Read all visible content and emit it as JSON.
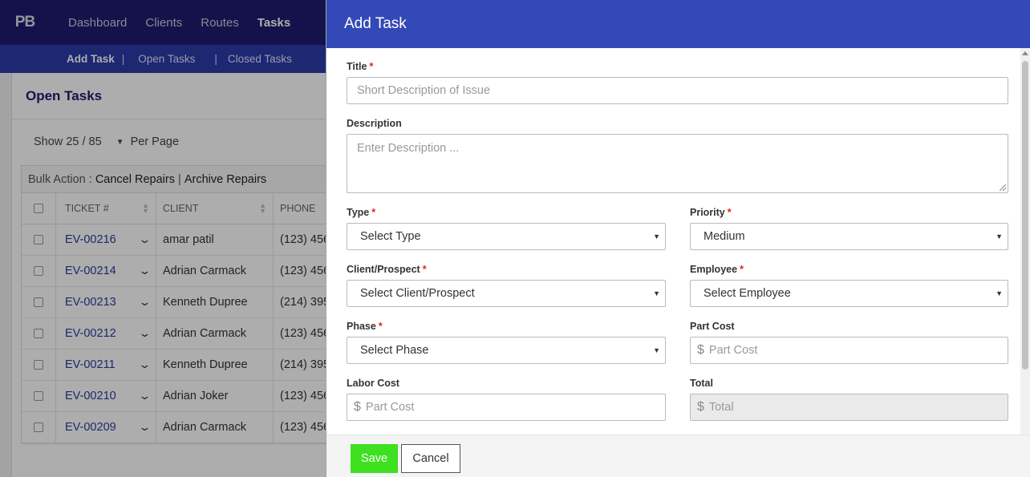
{
  "app": {
    "logo": "PB",
    "nav": [
      "Dashboard",
      "Clients",
      "Routes",
      "Tasks"
    ],
    "active_nav": "Tasks",
    "subnav": {
      "add_task": "Add Task",
      "open_tasks": "Open Tasks",
      "closed_tasks": "Closed Tasks",
      "separator": "|"
    }
  },
  "list": {
    "title": "Open Tasks",
    "show": "Show 25 / 85",
    "per_page": "Per Page",
    "bulk_label": "Bulk Action :",
    "bulk_cancel": "Cancel Repairs",
    "bulk_archive": "Archive Repairs",
    "bulk_sep": "|",
    "columns": [
      "TICKET #",
      "CLIENT",
      "PHONE"
    ],
    "rows": [
      {
        "ticket": "EV-00216",
        "client": "amar patil",
        "phone": "(123) 456"
      },
      {
        "ticket": "EV-00214",
        "client": "Adrian Carmack",
        "phone": "(123) 456"
      },
      {
        "ticket": "EV-00213",
        "client": "Kenneth Dupree",
        "phone": "(214) 395"
      },
      {
        "ticket": "EV-00212",
        "client": "Adrian Carmack",
        "phone": "(123) 456"
      },
      {
        "ticket": "EV-00211",
        "client": "Kenneth Dupree",
        "phone": "(214) 395"
      },
      {
        "ticket": "EV-00210",
        "client": "Adrian Joker",
        "phone": "(123) 456"
      },
      {
        "ticket": "EV-00209",
        "client": "Adrian Carmack",
        "phone": "(123) 456"
      }
    ]
  },
  "modal": {
    "title": "Add Task",
    "required_mark": "*",
    "fields": {
      "title": {
        "label": "Title",
        "placeholder": "Short Description of Issue"
      },
      "description": {
        "label": "Description",
        "placeholder": "Enter Description ..."
      },
      "type": {
        "label": "Type",
        "value": "Select Type"
      },
      "priority": {
        "label": "Priority",
        "value": "Medium"
      },
      "client": {
        "label": "Client/Prospect",
        "value": "Select Client/Prospect"
      },
      "employee": {
        "label": "Employee",
        "value": "Select Employee"
      },
      "phase": {
        "label": "Phase",
        "value": "Select Phase"
      },
      "part_cost": {
        "label": "Part Cost",
        "placeholder": "Part Cost",
        "prefix": "$"
      },
      "labor_cost": {
        "label": "Labor Cost",
        "placeholder": "Part Cost",
        "prefix": "$"
      },
      "total": {
        "label": "Total",
        "placeholder": "Total",
        "prefix": "$"
      }
    },
    "save": "Save",
    "cancel": "Cancel"
  }
}
